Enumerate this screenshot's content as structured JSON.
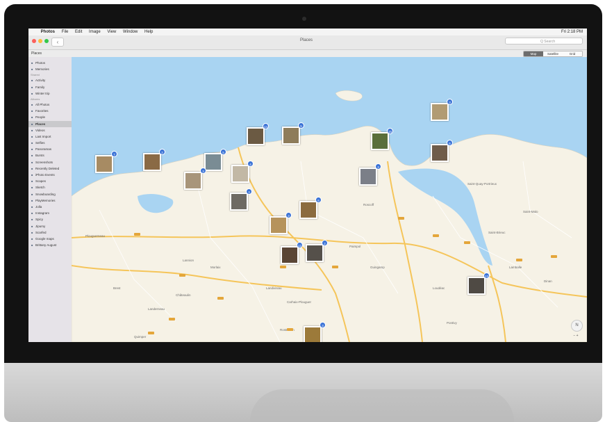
{
  "menubar": {
    "apple": "",
    "items": [
      "Photos",
      "File",
      "Edit",
      "Image",
      "View",
      "Window",
      "Help"
    ],
    "clock": "Fri 2:18 PM"
  },
  "toolbar": {
    "back": "‹",
    "title": "Places",
    "search_placeholder": "Q Search"
  },
  "subbar": {
    "title": "Places",
    "tabs": [
      "Map",
      "Satellite",
      "Grid"
    ],
    "active_tab": "Map"
  },
  "sidebar": {
    "library": [
      {
        "label": "Photos",
        "icon": "photos-icon"
      },
      {
        "label": "Memories",
        "icon": "memories-icon"
      }
    ],
    "shared_header": "Shared",
    "shared": [
      {
        "label": "Activity",
        "icon": "activity-icon"
      },
      {
        "label": "Family",
        "icon": "family-icon"
      },
      {
        "label": "Winter trip",
        "icon": "album-icon"
      }
    ],
    "albums_header": "Albums",
    "albums": [
      {
        "label": "All Photos",
        "icon": "album-icon"
      },
      {
        "label": "Favorites",
        "icon": "heart-icon"
      },
      {
        "label": "People",
        "icon": "person-icon"
      },
      {
        "label": "Places",
        "icon": "pin-icon",
        "active": true
      },
      {
        "label": "Videos",
        "icon": "video-icon"
      },
      {
        "label": "Last Import",
        "icon": "import-icon"
      },
      {
        "label": "Selfies",
        "icon": "selfie-icon"
      },
      {
        "label": "Panoramas",
        "icon": "panorama-icon"
      },
      {
        "label": "Bursts",
        "icon": "burst-icon"
      },
      {
        "label": "Screenshots",
        "icon": "screenshot-icon"
      },
      {
        "label": "Recently Deleted",
        "icon": "trash-icon"
      },
      {
        "label": "iPhoto Events",
        "icon": "folder-icon"
      },
      {
        "label": "Scapes",
        "icon": "album-thumb-icon"
      },
      {
        "label": "Sketch",
        "icon": "album-thumb-icon"
      },
      {
        "label": "Snowboarding",
        "icon": "album-thumb-icon"
      },
      {
        "label": "PlayMemories",
        "icon": "album-thumb-icon"
      },
      {
        "label": "Jolla",
        "icon": "album-thumb-icon"
      },
      {
        "label": "Instagram",
        "icon": "album-thumb-icon"
      },
      {
        "label": "Spicy",
        "icon": "album-thumb-icon"
      },
      {
        "label": "Jipumy",
        "icon": "album-thumb-icon"
      },
      {
        "label": "Scarfed",
        "icon": "album-thumb-icon"
      },
      {
        "label": "Google maps",
        "icon": "album-thumb-icon"
      },
      {
        "label": "Brittany August",
        "icon": "album-thumb-icon"
      }
    ]
  },
  "map": {
    "towns": [
      "Plouguerneau",
      "Lannion",
      "Morlaix",
      "Brest",
      "Landerneau",
      "Landivisiau",
      "Carhaix-Plouguer",
      "Paimpol",
      "Guingamp",
      "Saint-Brieuc",
      "Roscoff",
      "Lamballe",
      "Loudéac",
      "Pontivy",
      "Quimper",
      "Châteaulin",
      "Rostrenen",
      "Saint-Malo",
      "Dinan",
      "Saint-Quay-Portrieux"
    ],
    "pins": [
      {
        "count": "7",
        "color": "#a78b63"
      },
      {
        "count": "2",
        "color": "#8a6a45"
      },
      {
        "count": "5",
        "color": "#7a8c94"
      },
      {
        "count": "3",
        "color": "#a8957a"
      },
      {
        "count": "4",
        "color": "#c2b8a5"
      },
      {
        "count": "14",
        "color": "#6b5a43"
      },
      {
        "count": "5",
        "color": "#8e7c5a"
      },
      {
        "count": "15",
        "color": "#5a6f3b"
      },
      {
        "count": "6",
        "color": "#6f5c4a"
      },
      {
        "count": "3",
        "color": "#7b7f88"
      },
      {
        "count": "6",
        "color": "#8b6b3f"
      },
      {
        "count": "3",
        "color": "#b6935c"
      },
      {
        "count": "12",
        "color": "#5a4535"
      },
      {
        "count": "2",
        "color": "#55504a"
      },
      {
        "count": "13",
        "color": "#4f4a44"
      },
      {
        "count": "3",
        "color": "#9c7a3a"
      },
      {
        "count": "3",
        "color": "#6e6a63"
      },
      {
        "count": "3",
        "color": "#b19b73"
      }
    ],
    "compass": "N",
    "zoom": "− +"
  },
  "colors": {
    "water": "#a9d4f2",
    "land": "#f6f2e6",
    "road": "#f5c55a",
    "badge": "#3b73d6"
  }
}
